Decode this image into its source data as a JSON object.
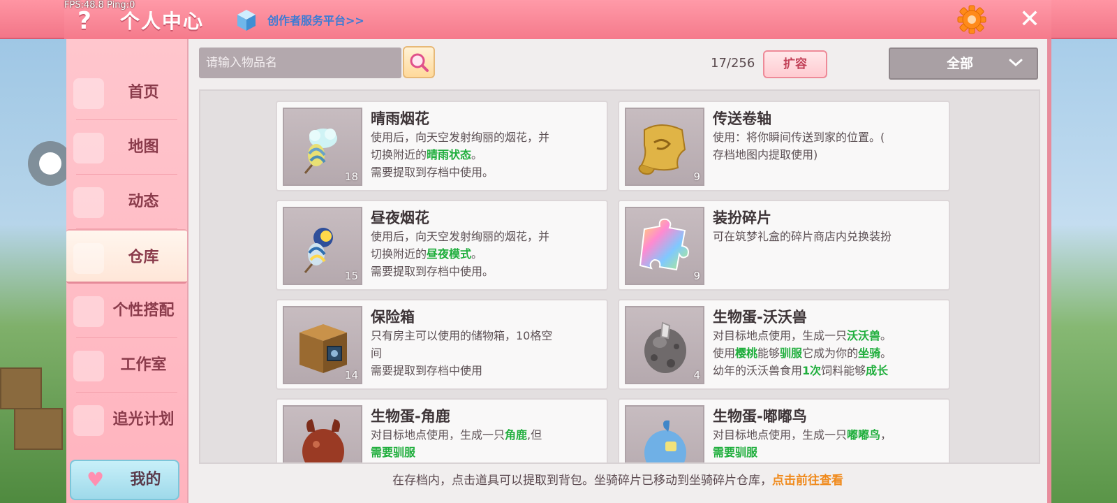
{
  "overlay": {
    "fps_text": "FPS:48.8  Ping:0"
  },
  "header": {
    "help": "?",
    "title": "个人中心",
    "creator_link": "创作者服务平台>>",
    "close": "✕"
  },
  "sidebar": {
    "items": [
      {
        "label": "首页"
      },
      {
        "label": "地图"
      },
      {
        "label": "动态"
      },
      {
        "label": "仓库",
        "active": true
      },
      {
        "label": "个性搭配"
      },
      {
        "label": "工作室"
      },
      {
        "label": "追光计划"
      }
    ],
    "my_button": "我的"
  },
  "toolbar": {
    "search_placeholder": "请输入物品名",
    "capacity": "17/256",
    "expand_label": "扩容",
    "filter_value": "全部"
  },
  "items": [
    {
      "name": "晴雨烟花",
      "count": "18",
      "icon": "umbrella-firework-icon",
      "desc": [
        "使用后，向天空发射绚丽的烟花，并",
        "切换附近的",
        "晴雨状态",
        "。",
        "需要提取到存档中使用。"
      ]
    },
    {
      "name": "传送卷轴",
      "count": "9",
      "icon": "scroll-icon",
      "desc": [
        "使用：将你瞬间传送到家的位置。(",
        "存档地图内提取使用)"
      ]
    },
    {
      "name": "昼夜烟花",
      "count": "15",
      "icon": "daynight-firework-icon",
      "desc": [
        "使用后，向天空发射绚丽的烟花，并",
        "切换附近的",
        "昼夜模式",
        "。",
        "需要提取到存档中使用。"
      ]
    },
    {
      "name": "装扮碎片",
      "count": "9",
      "icon": "puzzle-piece-icon",
      "desc": [
        "可在筑梦礼盒的碎片商店内兑换装扮"
      ]
    },
    {
      "name": "保险箱",
      "count": "14",
      "icon": "safe-box-icon",
      "desc": [
        "只有房主可以使用的储物箱，10格空",
        "间",
        "需要提取到存档中使用"
      ]
    },
    {
      "name": "生物蛋-沃沃兽",
      "count": "4",
      "icon": "egg-icon",
      "desc": [
        "对目标地点使用，生成一只",
        "沃沃兽",
        "。",
        "使用",
        "樱桃",
        "能够",
        "驯服",
        "它成为你的",
        "坐骑",
        "。",
        "幼年的沃沃兽食用",
        "1次",
        "饲料能够",
        "成长"
      ]
    },
    {
      "name": "生物蛋-角鹿",
      "count": "",
      "icon": "deer-egg-icon",
      "desc": [
        "对目标地点使用，生成一只",
        "角鹿",
        ",但",
        "需要驯服"
      ]
    },
    {
      "name": "生物蛋-嘟嘟鸟",
      "count": "",
      "icon": "bird-egg-icon",
      "desc": [
        "对目标地点使用，生成一只",
        "嘟嘟鸟",
        "，",
        "需要驯服"
      ]
    }
  ],
  "footer": {
    "tip": "在存档内，点击道具可以提取到背包。坐骑碎片已移动到坐骑碎片仓库，",
    "link": "点击前往查看"
  }
}
